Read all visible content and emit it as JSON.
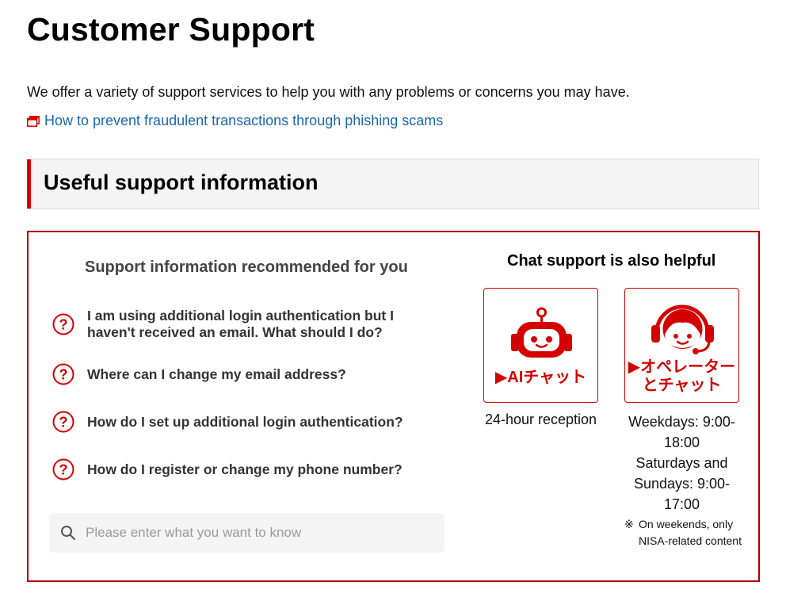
{
  "page": {
    "title": "Customer Support",
    "intro": "We offer a variety of support services to help you with any problems or concerns you may have.",
    "phishing_link": "How to prevent fraudulent transactions through phishing scams"
  },
  "section": {
    "heading": "Useful support information"
  },
  "recommended": {
    "heading": "Support information recommended for you",
    "items": [
      {
        "text": "I am using additional login authentication but I haven't received an email. What should I do?"
      },
      {
        "text": "Where can I change my email address?"
      },
      {
        "text": "How do I set up additional login authentication?"
      },
      {
        "text": "How do I register or change my phone number?"
      }
    ],
    "search_placeholder": "Please enter what you want to know"
  },
  "chat": {
    "heading": "Chat support is also helpful",
    "ai": {
      "label": "▶AIチャット",
      "hours": "24-hour reception"
    },
    "operator": {
      "label_line1": "▶オペレーター",
      "label_line2": "とチャット",
      "hours_weekday": "Weekdays: 9:00-18:00",
      "hours_weekend": "Saturdays and Sundays: 9:00-17:00",
      "note_mark": "※",
      "note": "On weekends, only NISA-related content"
    }
  },
  "colors": {
    "brand_red": "#d40000",
    "link_blue": "#1a66b3"
  },
  "icons": {
    "link": "external-window-icon",
    "faq": "question-circle-icon",
    "search": "search-icon",
    "ai": "robot-icon",
    "operator": "operator-headset-icon"
  }
}
